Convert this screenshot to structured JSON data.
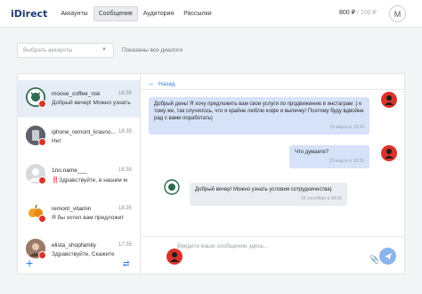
{
  "header": {
    "logo": "iDirect",
    "nav": [
      "Аккаунты",
      "Сообщения",
      "Аудитория",
      "Рассылки"
    ],
    "active_nav": "Сообщения",
    "balance": "800 ₽",
    "balance_sep": " / ",
    "bonus": "100 ₽",
    "avatar_letter": "M"
  },
  "filter": {
    "select_placeholder": "Выбрать аккаунты",
    "status_text": "Показаны все диалоги"
  },
  "dialogs": [
    {
      "name": "moose_coffee_nsk",
      "time": "18:35",
      "preview": "Добрый вечер! Можно узнать",
      "active": true,
      "avatar_color": "#2e6b4f"
    },
    {
      "name": "iphone_remont_krasno...",
      "time": "18:35",
      "preview": "Нет",
      "active": false,
      "avatar_color": "#7a7f88"
    },
    {
      "name": "1no.name___",
      "time": "18:35",
      "preview": "‼️Здравствуйте, в нашем м",
      "active": false,
      "avatar_color": "#d7d9dd"
    },
    {
      "name": "remont_vitamin",
      "time": "18:35",
      "preview": "Я бы хотел вам предложит",
      "active": false,
      "avatar_color": "#f0a02b"
    },
    {
      "name": "elista_shopfamily",
      "time": "17:35",
      "preview": "Здравствуйте, Скажите",
      "active": false,
      "avatar_color": "#8a6a5b"
    }
  ],
  "chat": {
    "back_label": "Назад",
    "messages": [
      {
        "direction": "out",
        "text": "Добрый день! Я хочу предложить вам свои услуги по продвижению в инстаграм :) к тому же, так случилось, что я крайне люблю кофе и выпечку! Поэтому буду вдвойне рад с вами поработать)",
        "stamp": "23 марта в 18:34"
      },
      {
        "direction": "out",
        "text": "Что думаете?",
        "stamp": "23 марта в 18:35"
      },
      {
        "direction": "in",
        "text": "Добрый вечер! Можно узнать условия сотрудничества)",
        "stamp": "19 сентября в 18:35"
      }
    ],
    "composer_placeholder": "Введите ваше сообщение здесь..."
  },
  "icons": {
    "plus": "plus-icon",
    "swap": "swap-icon",
    "clip": "paperclip-icon",
    "smile": "smile-icon",
    "send": "send-icon"
  },
  "colors": {
    "accent": "#2f7de1",
    "bubble_out": "#d6e2f7",
    "bubble_in": "#e9ecf1",
    "badge": "#d9342b",
    "send": "#8ab4ea"
  }
}
